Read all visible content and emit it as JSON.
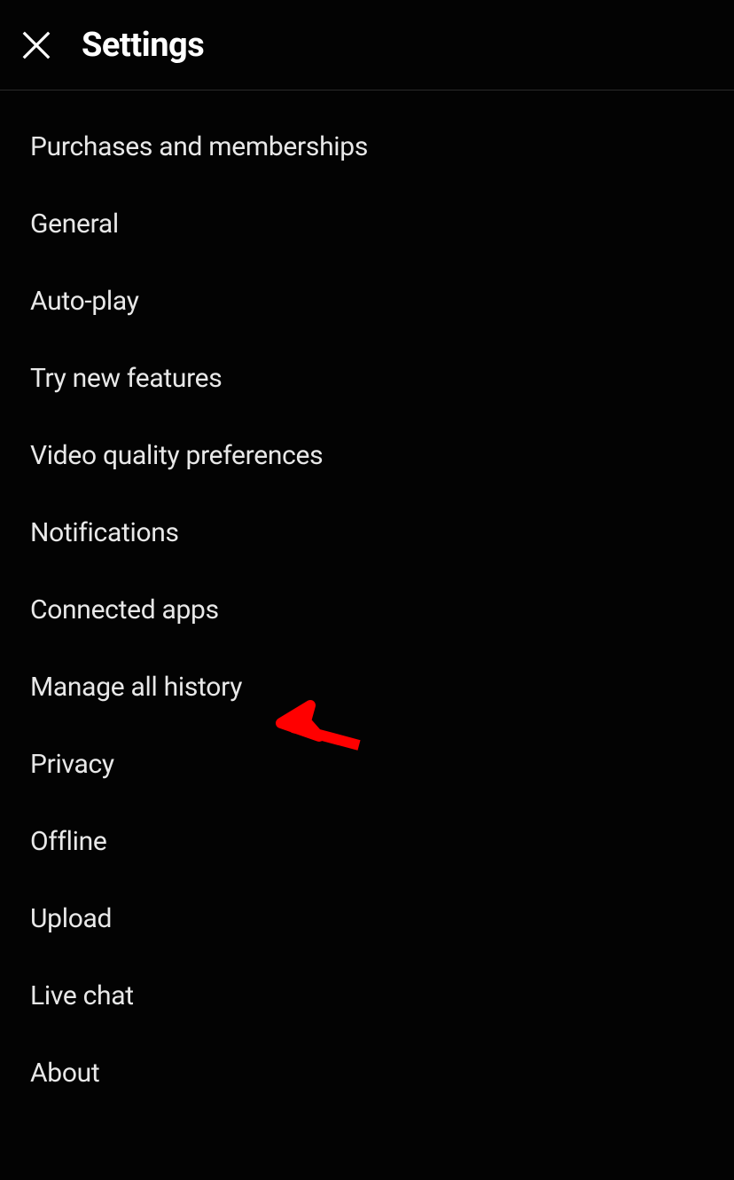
{
  "header": {
    "title": "Settings"
  },
  "settings": {
    "items": [
      {
        "id": "purchases",
        "label": "Purchases and memberships"
      },
      {
        "id": "general",
        "label": "General"
      },
      {
        "id": "autoplay",
        "label": "Auto-play"
      },
      {
        "id": "try-new-features",
        "label": "Try new features"
      },
      {
        "id": "video-quality",
        "label": "Video quality preferences"
      },
      {
        "id": "notifications",
        "label": "Notifications"
      },
      {
        "id": "connected-apps",
        "label": "Connected apps"
      },
      {
        "id": "manage-history",
        "label": "Manage all history"
      },
      {
        "id": "privacy",
        "label": "Privacy"
      },
      {
        "id": "offline",
        "label": "Offline"
      },
      {
        "id": "upload",
        "label": "Upload"
      },
      {
        "id": "live-chat",
        "label": "Live chat"
      },
      {
        "id": "about",
        "label": "About"
      }
    ]
  },
  "annotation": {
    "target_item": "manage-history",
    "color": "#ff0000"
  }
}
